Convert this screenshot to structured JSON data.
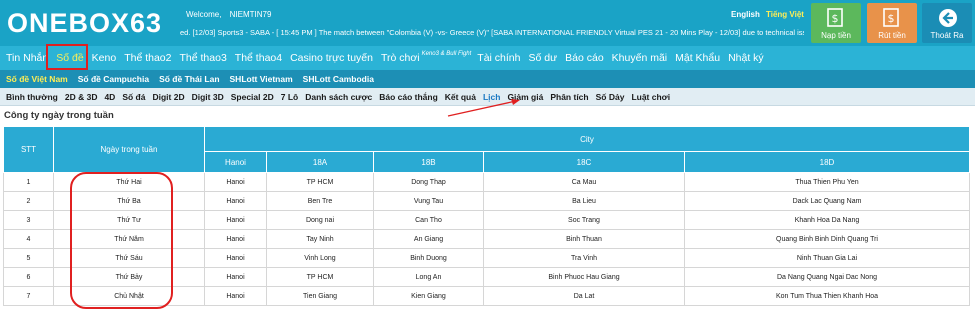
{
  "header": {
    "logo": "ONEBOX63",
    "welcome_label": "Welcome,",
    "username": "NIEMTIN79",
    "ticker": "ed.     [12/03] Sports3 - SABA - [ 15:45 PM ] The match between \"Colombia (V) -vs- Greece (V)\" [SABA INTERNATIONAL FRIENDLY Virtual PES 21 - 20 Mins Play - 12/03] due to technical issue",
    "lang_en": "English",
    "lang_vi": "Tiếng Việt",
    "buttons": {
      "deposit": "Nạp tiền",
      "withdraw": "Rút tiền",
      "logout": "Thoát Ra"
    }
  },
  "nav_main": [
    "Tin Nhắn",
    "Số đề",
    "Keno",
    "Thể thao2",
    "Thể thao3",
    "Thể thao4",
    "Casino trực tuyến",
    "Trò chơi",
    "Tài chính",
    "Số dư",
    "Báo cáo",
    "Khuyến mãi",
    "Mật Khẩu",
    "Nhật ký"
  ],
  "nav_main_sup": "Keno3 & Bull Fight",
  "nav_sub": [
    "Số đề Việt Nam",
    "Số đề Campuchia",
    "Số đề Thái Lan",
    "SHLott Vietnam",
    "SHLott Cambodia"
  ],
  "nav_third": [
    "Bình thường",
    "2D & 3D",
    "4D",
    "Số đá",
    "Digit 2D",
    "Digit 3D",
    "Special 2D",
    "7 Lô",
    "Danh sách cược",
    "Báo cáo thắng",
    "Kết quả",
    "Lịch",
    "Giảm giá",
    "Phân tích",
    "Số Dảy",
    "Luật chơi"
  ],
  "caption": "Công ty ngày trong tuần",
  "table": {
    "head_stt": "STT",
    "head_day": "Ngày trong tuần",
    "head_city": "City",
    "sub_heads": [
      "Hanoi",
      "18A",
      "18B",
      "18C",
      "18D"
    ],
    "rows": [
      {
        "stt": "1",
        "day": "Thứ Hai",
        "hanoi": "Hanoi",
        "a": "TP HCM",
        "b": "Dong Thap",
        "c": "Ca Mau",
        "d": "Thua Thien  Phu Yen"
      },
      {
        "stt": "2",
        "day": "Thứ Ba",
        "hanoi": "Hanoi",
        "a": "Ben Tre",
        "b": "Vung Tau",
        "c": "Ba Lieu",
        "d": "Dack Lac  Quang Nam"
      },
      {
        "stt": "3",
        "day": "Thứ Tư",
        "hanoi": "Hanoi",
        "a": "Dong nai",
        "b": "Can Tho",
        "c": "Soc Trang",
        "d": "Khanh Hoa  Da Nang"
      },
      {
        "stt": "4",
        "day": "Thứ Năm",
        "hanoi": "Hanoi",
        "a": "Tay Ninh",
        "b": "An Giang",
        "c": "Binh Thuan",
        "d": "Quang Binh  Binh Dinh  Quang Tri"
      },
      {
        "stt": "5",
        "day": "Thứ Sáu",
        "hanoi": "Hanoi",
        "a": "Vinh Long",
        "b": "Binh Duong",
        "c": "Tra Vinh",
        "d": "Ninh Thuan  Gia Lai"
      },
      {
        "stt": "6",
        "day": "Thứ Bảy",
        "hanoi": "Hanoi",
        "a": "TP HCM",
        "b": "Long An",
        "c": "Binh Phuoc  Hau Giang",
        "d": "Da Nang  Quang Ngai  Dac Nong"
      },
      {
        "stt": "7",
        "day": "Chủ Nhật",
        "hanoi": "Hanoi",
        "a": "Tien Giang",
        "b": "Kien Giang",
        "c": "Da Lat",
        "d": "Kon Tum  Thua Thien  Khanh Hoa"
      }
    ]
  }
}
